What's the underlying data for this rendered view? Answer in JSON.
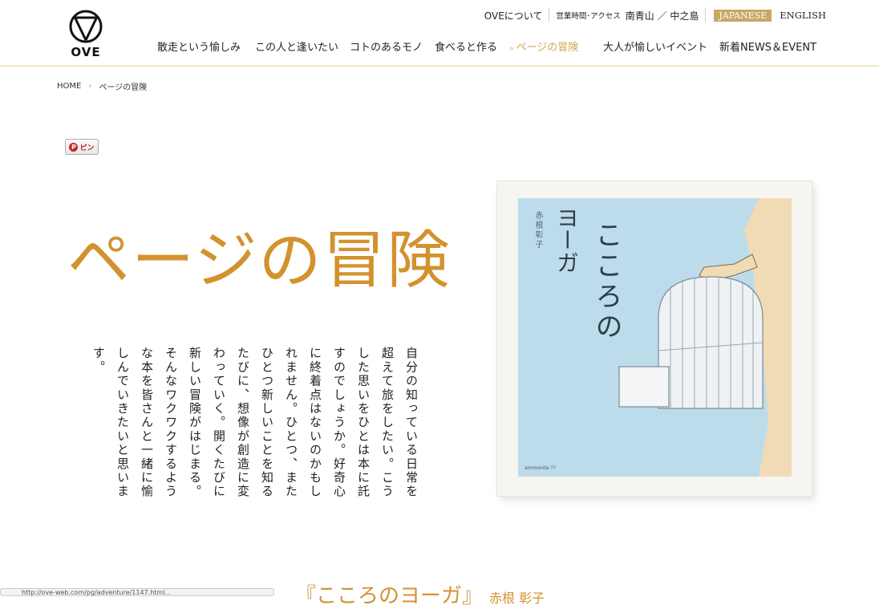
{
  "header": {
    "logo_text": "OVE",
    "utility": {
      "about": "OVEについて",
      "hours": "営業時間･アクセス",
      "locations": "南青山 ／ 中之島",
      "lang_jp": "JAPANESE",
      "lang_en": "ENGLISH"
    },
    "nav": [
      {
        "label": "散走という愉しみ"
      },
      {
        "label": "この人と逢いたい"
      },
      {
        "label": "コトのあるモノ"
      },
      {
        "label": "食べると作る"
      },
      {
        "label": "ページの冒険",
        "active": true
      },
      {
        "label": "大人が愉しいイベント"
      },
      {
        "label": "新着NEWS＆EVENT"
      }
    ]
  },
  "breadcrumb": {
    "home": "HOME",
    "current": "ページの冒険"
  },
  "pin_label": "ピン",
  "page_title": "ページの冒険",
  "intro_text": "自分の知っている日常を超えて旅をしたい。こうした思いをひとは本に託すのでしょうか。好奇心に終着点はないのかもしれません。ひとつ、またひとつ新しいことを知るたびに、想像が創造に変わっていく。開くたびに新しい冒険がはじまる。そんなワクワクするような本を皆さんと一緒に愉しんでいきたいと思います。",
  "book": {
    "title": "こころの",
    "subtitle": "ヨーガ",
    "author": "赤根彰子",
    "publisher": "ammonite ??"
  },
  "bottom": {
    "status_text": "http://ove-web.com/pg/adventure/1147.html...",
    "heading": "『こころのヨーガ』",
    "author": "赤根 彰子"
  },
  "colors": {
    "accent": "#d3922e",
    "nav_active": "#d7a44c",
    "lang_active_bg": "#c9a866",
    "cover_bg": "#bcdcec"
  }
}
